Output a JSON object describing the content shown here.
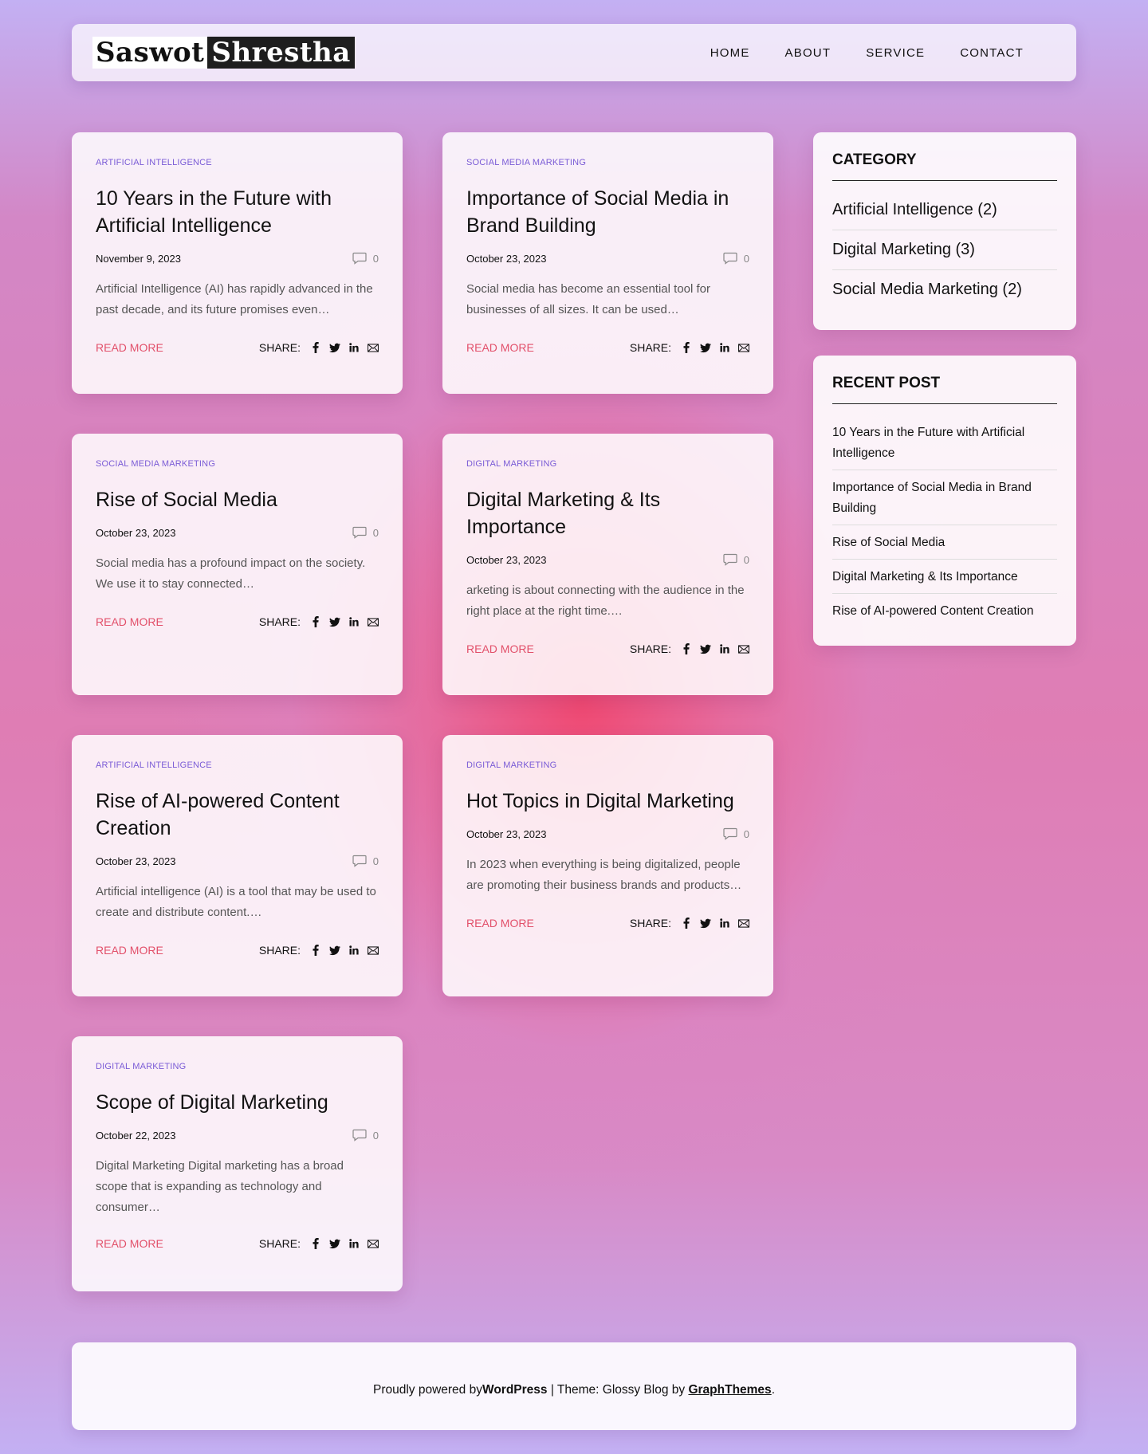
{
  "header": {
    "logo_part1": "Saswot",
    "logo_part2": "Shrestha",
    "nav": [
      "HOME",
      "ABOUT",
      "SERVICE",
      "CONTACT"
    ]
  },
  "labels": {
    "read_more": "READ MORE",
    "share": "SHARE:"
  },
  "posts": [
    {
      "category": "ARTIFICIAL INTELLIGENCE",
      "title": "10 Years in the Future with Artificial Intelligence",
      "date": "November 9, 2023",
      "comments": "0",
      "excerpt": "Artificial Intelligence (AI) has rapidly advanced in the past decade, and its future promises even…"
    },
    {
      "category": "SOCIAL MEDIA MARKETING",
      "title": "Importance of Social Media in Brand Building",
      "date": "October 23, 2023",
      "comments": "0",
      "excerpt": "Social media has become an essential tool for businesses of all sizes. It can be used…"
    },
    {
      "category": "SOCIAL MEDIA MARKETING",
      "title": "Rise of Social Media",
      "date": "October 23, 2023",
      "comments": "0",
      "excerpt": "Social media has a profound impact on the society. We use it to stay connected…"
    },
    {
      "category": "DIGITAL MARKETING",
      "title": "Digital Marketing & Its Importance",
      "date": "October 23, 2023",
      "comments": "0",
      "excerpt": "arketing is about connecting with the audience in the right place at the right time.…"
    },
    {
      "category": "ARTIFICIAL INTELLIGENCE",
      "title": "Rise of AI-powered Content Creation",
      "date": "October 23, 2023",
      "comments": "0",
      "excerpt": "Artificial intelligence (AI) is a tool that may be used to create and distribute content.…"
    },
    {
      "category": "DIGITAL MARKETING",
      "title": "Hot Topics in Digital Marketing",
      "date": "October 23, 2023",
      "comments": "0",
      "excerpt": "In 2023 when everything is being digitalized, people are promoting their business brands and products…"
    },
    {
      "category": "DIGITAL MARKETING",
      "title": "Scope of Digital Marketing",
      "date": "October 22, 2023",
      "comments": "0",
      "excerpt": "Digital Marketing Digital marketing has a broad scope that is expanding as technology and consumer…"
    }
  ],
  "sidebar": {
    "category_title": "CATEGORY",
    "categories": [
      "Artificial Intelligence (2)",
      "Digital Marketing (3)",
      "Social Media Marketing (2)"
    ],
    "recent_title": "RECENT POST",
    "recent": [
      "10 Years in the Future with Artificial Intelligence",
      "Importance of Social Media in Brand Building",
      "Rise of Social Media",
      "Digital Marketing & Its Importance",
      "Rise of AI-powered Content Creation"
    ]
  },
  "footer": {
    "powered_prefix": "Proudly powered by ",
    "wordpress": "WordPress",
    "theme_text": " | Theme: Glossy Blog by ",
    "graphthemes": "GraphThemes",
    "suffix": "."
  },
  "colors": {
    "category": "#7a5bd6",
    "read_more": "#e2506a"
  }
}
